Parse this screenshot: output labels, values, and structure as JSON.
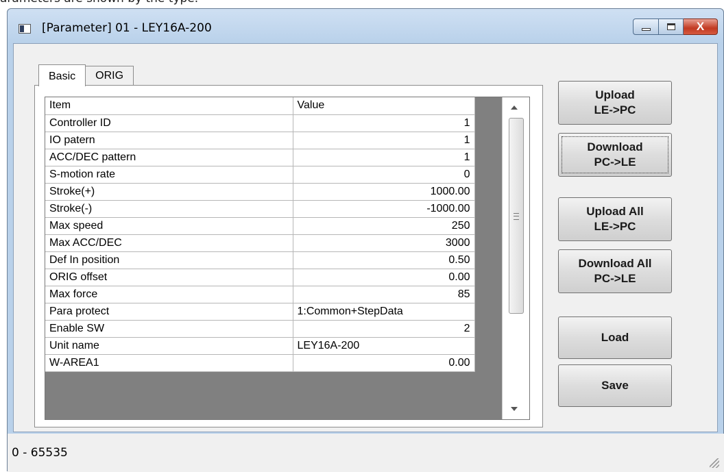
{
  "document_snippet": "arameters are shown by the type.",
  "window": {
    "title": "[Parameter] 01 - LEY16A-200",
    "minimize_label": "",
    "maximize_label": "",
    "close_label": "X"
  },
  "tabs": [
    {
      "label": "Basic",
      "active": true
    },
    {
      "label": "ORIG",
      "active": false
    }
  ],
  "grid": {
    "columns": [
      "Item",
      "Value"
    ],
    "rows": [
      {
        "item": "Controller ID",
        "value": "1",
        "align": "right"
      },
      {
        "item": "IO patern",
        "value": "1",
        "align": "right"
      },
      {
        "item": "ACC/DEC pattern",
        "value": "1",
        "align": "right"
      },
      {
        "item": "S-motion rate",
        "value": "0",
        "align": "right"
      },
      {
        "item": "Stroke(+)",
        "value": "1000.00",
        "align": "right"
      },
      {
        "item": "Stroke(-)",
        "value": "-1000.00",
        "align": "right"
      },
      {
        "item": "Max speed",
        "value": "250",
        "align": "right"
      },
      {
        "item": "Max ACC/DEC",
        "value": "3000",
        "align": "right"
      },
      {
        "item": "Def In position",
        "value": "0.50",
        "align": "right"
      },
      {
        "item": "ORIG offset",
        "value": "0.00",
        "align": "right"
      },
      {
        "item": "Max force",
        "value": "85",
        "align": "right"
      },
      {
        "item": "Para protect",
        "value": "1:Common+StepData",
        "align": "left"
      },
      {
        "item": "Enable SW",
        "value": "2",
        "align": "right"
      },
      {
        "item": "Unit name",
        "value": "LEY16A-200",
        "align": "left"
      },
      {
        "item": "W-AREA1",
        "value": "0.00",
        "align": "right"
      }
    ]
  },
  "buttons": {
    "upload": {
      "line1": "Upload",
      "line2": "LE->PC"
    },
    "download": {
      "line1": "Download",
      "line2": "PC->LE"
    },
    "upload_all": {
      "line1": "Upload All",
      "line2": "LE->PC"
    },
    "download_all": {
      "line1": "Download All",
      "line2": "PC->LE"
    },
    "load": {
      "label": "Load"
    },
    "save": {
      "label": "Save"
    }
  },
  "status": {
    "text": "0 - 65535"
  },
  "colors": {
    "window_frame": "#b9d1ea",
    "close_button": "#c23a22",
    "grid_gutter": "#808080"
  }
}
